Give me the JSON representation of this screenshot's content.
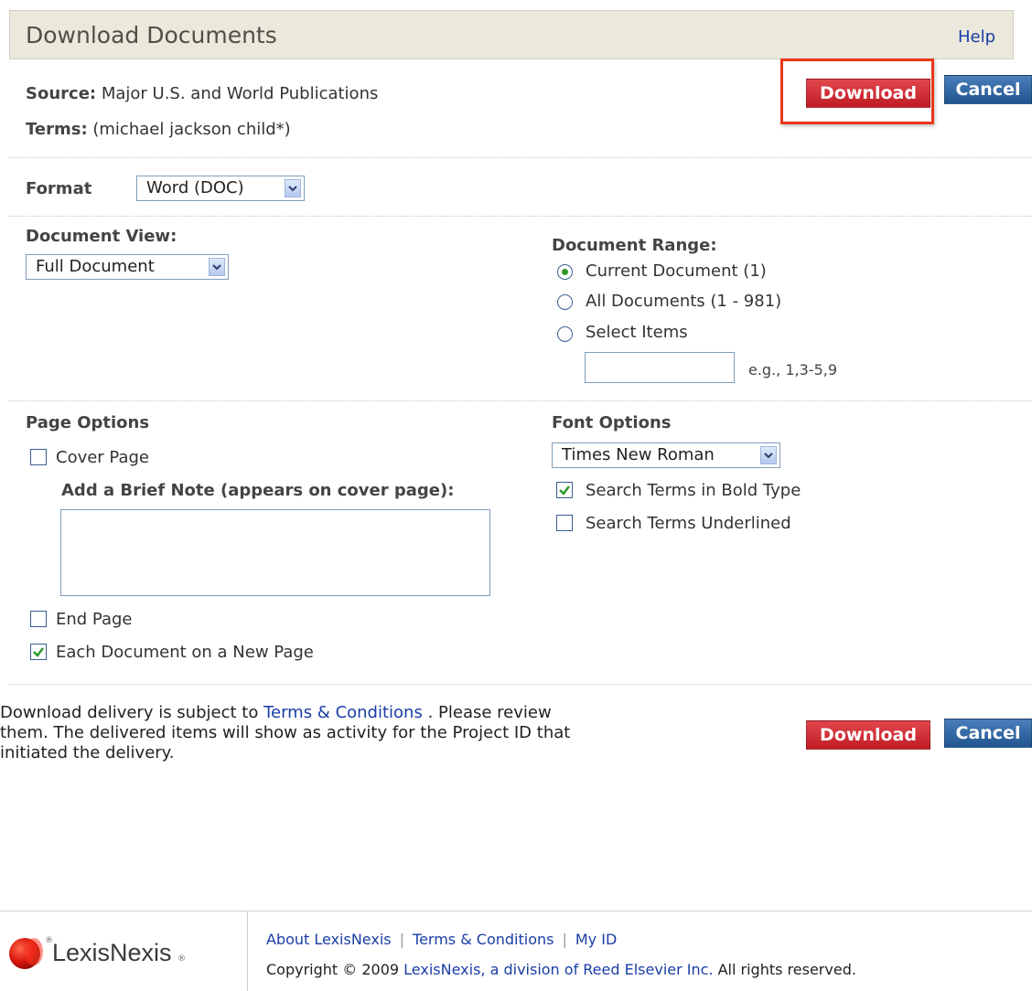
{
  "header": {
    "title": "Download Documents",
    "help": "Help"
  },
  "source": {
    "label": "Source:",
    "value": "Major U.S. and World Publications"
  },
  "terms": {
    "label": "Terms:",
    "value": "(michael jackson child*)"
  },
  "buttons": {
    "download": "Download",
    "cancel": "Cancel"
  },
  "format": {
    "label": "Format",
    "selected": "Word (DOC)"
  },
  "document_view": {
    "label": "Document View:",
    "selected": "Full Document"
  },
  "document_range": {
    "label": "Document Range:",
    "options": [
      {
        "label": "Current Document (1)",
        "checked": true
      },
      {
        "label": "All Documents (1 - 981)",
        "checked": false
      },
      {
        "label": "Select Items",
        "checked": false
      }
    ],
    "hint": "e.g., 1,3-5,9"
  },
  "page_options": {
    "label": "Page Options",
    "cover_page": {
      "label": "Cover Page",
      "checked": false
    },
    "note_label": "Add a Brief Note (appears on cover page):",
    "end_page": {
      "label": "End Page",
      "checked": false
    },
    "each_doc": {
      "label": "Each Document on a New Page",
      "checked": true
    }
  },
  "font_options": {
    "label": "Font Options",
    "selected": "Times New Roman",
    "bold": {
      "label": "Search Terms in Bold Type",
      "checked": true
    },
    "underlined": {
      "label": "Search Terms Underlined",
      "checked": false
    }
  },
  "notice": {
    "pre": "Download delivery is subject to",
    "link": "Terms & Conditions",
    "post_line1": ". Please review",
    "line2": "them. The delivered items will show as activity for the Project ID that",
    "line3": "initiated the delivery."
  },
  "footer": {
    "logo_text": "LexisNexis",
    "logo_mark": "®",
    "links": [
      "About LexisNexis",
      "Terms & Conditions",
      "My ID"
    ],
    "copyright_pre": "Copyright © 2009",
    "copyright_link": "LexisNexis, a division of Reed Elsevier Inc.",
    "copyright_post": "All rights reserved."
  },
  "colors": {
    "download": "#d02a31",
    "cancel": "#2f639f",
    "link": "#1a3da6",
    "highlight": "#e8381a",
    "header_bg": "#ebe8dc"
  }
}
